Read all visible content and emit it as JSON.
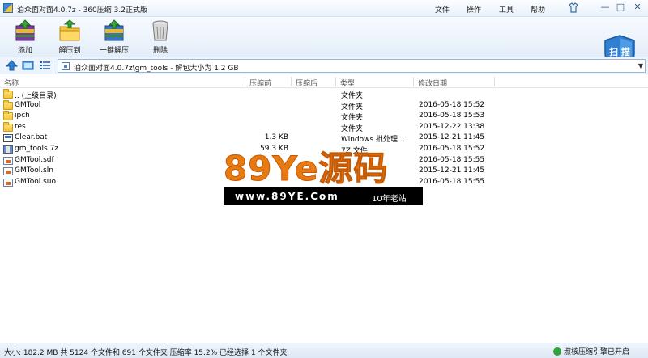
{
  "window": {
    "title": "泊众面对面4.0.7z - 360压缩 3.2正式版",
    "menus": [
      "文件",
      "操作",
      "工具",
      "帮助"
    ],
    "min_glyph": "—",
    "max_glyph": "□",
    "close_glyph": "✕"
  },
  "toolbar": {
    "add": "添加",
    "extract_to": "解压到",
    "one_click_extract": "一键解压",
    "delete": "删除",
    "scan": "扫 描"
  },
  "address": {
    "path": "泊众面对面4.0.7z\\gm_tools - 解包大小为 1.2 GB",
    "dropdown": "▼"
  },
  "columns": {
    "name": "名称",
    "packed": "压缩前",
    "size": "压缩后",
    "type": "类型",
    "modified": "修改日期"
  },
  "files": [
    {
      "icon": "folder",
      "name": ".. (上级目录)",
      "packed": "",
      "type": "文件夹",
      "date": ""
    },
    {
      "icon": "folder",
      "name": "GMTool",
      "packed": "",
      "type": "文件夹",
      "date": "2016-05-18 15:52"
    },
    {
      "icon": "folder",
      "name": "ipch",
      "packed": "",
      "type": "文件夹",
      "date": "2016-05-18 15:53"
    },
    {
      "icon": "folder",
      "name": "res",
      "packed": "",
      "type": "文件夹",
      "date": "2015-12-22 13:38"
    },
    {
      "icon": "bat",
      "name": "Clear.bat",
      "packed": "1.3 KB",
      "type": "Windows 批处理...",
      "date": "2015-12-21 11:45"
    },
    {
      "icon": "zip",
      "name": "gm_tools.7z",
      "packed": "59.3 KB",
      "type": "7Z 文件",
      "date": "2016-05-18 15:52"
    },
    {
      "icon": "doc",
      "name": "GMTool.sdf",
      "packed": "",
      "type": "",
      "date": "2016-05-18 15:55"
    },
    {
      "icon": "doc",
      "name": "GMTool.sln",
      "packed": "",
      "type": "",
      "date": "2015-12-21 11:45"
    },
    {
      "icon": "doc",
      "name": "GMTool.suo",
      "packed": "",
      "type": "",
      "date": "2016-05-18 15:55"
    }
  ],
  "watermark": {
    "big": "89Ye源码",
    "url": "www.89YE.Com",
    "tag": "10年老站"
  },
  "status": {
    "text": "大小: 182.2 MB 共 5124 个文件和 691 个文件夹 压缩率 15.2% 已经选择 1 个文件夹",
    "right": "淑核压缩引擎已开启"
  }
}
